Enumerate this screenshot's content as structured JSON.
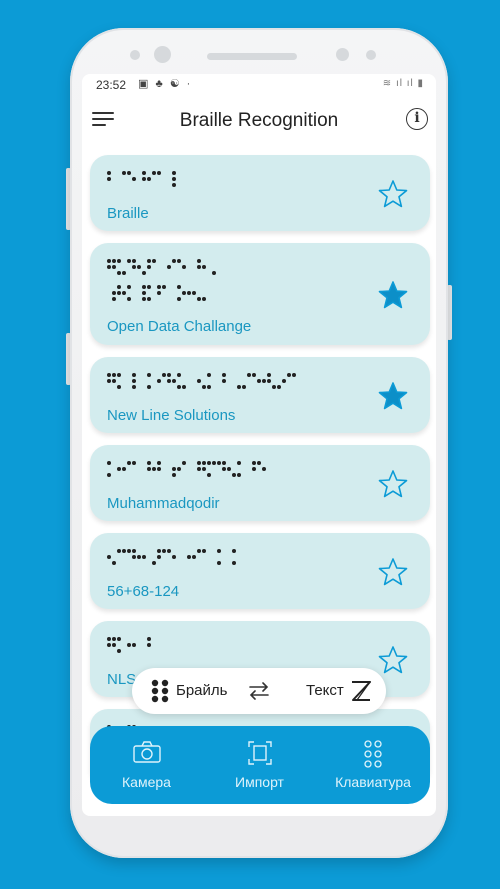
{
  "status": {
    "time": "23:52",
    "icons": "▣ ♣ ☯ ·",
    "right": "≋ ıl ıl ▮"
  },
  "appbar": {
    "title": "Braille Recognition"
  },
  "cards": [
    {
      "label": "Braille",
      "favorite": false
    },
    {
      "label": "Open Data Challange",
      "favorite": true
    },
    {
      "label": "New Line Solutions",
      "favorite": true
    },
    {
      "label": "Muhammadqodir",
      "favorite": false
    },
    {
      "label": "56+68-124",
      "favorite": false
    },
    {
      "label": "NLS",
      "favorite": false
    }
  ],
  "toggle": {
    "left_label": "Брайль",
    "right_label": "Текст"
  },
  "tabs": [
    {
      "label": "Камера",
      "icon": "camera-icon"
    },
    {
      "label": "Импорт",
      "icon": "import-icon"
    },
    {
      "label": "Клавиатура",
      "icon": "keyboard-icon"
    }
  ],
  "colors": {
    "accent": "#0c9bd6",
    "card": "#d3ecee",
    "label": "#1a97c1"
  }
}
